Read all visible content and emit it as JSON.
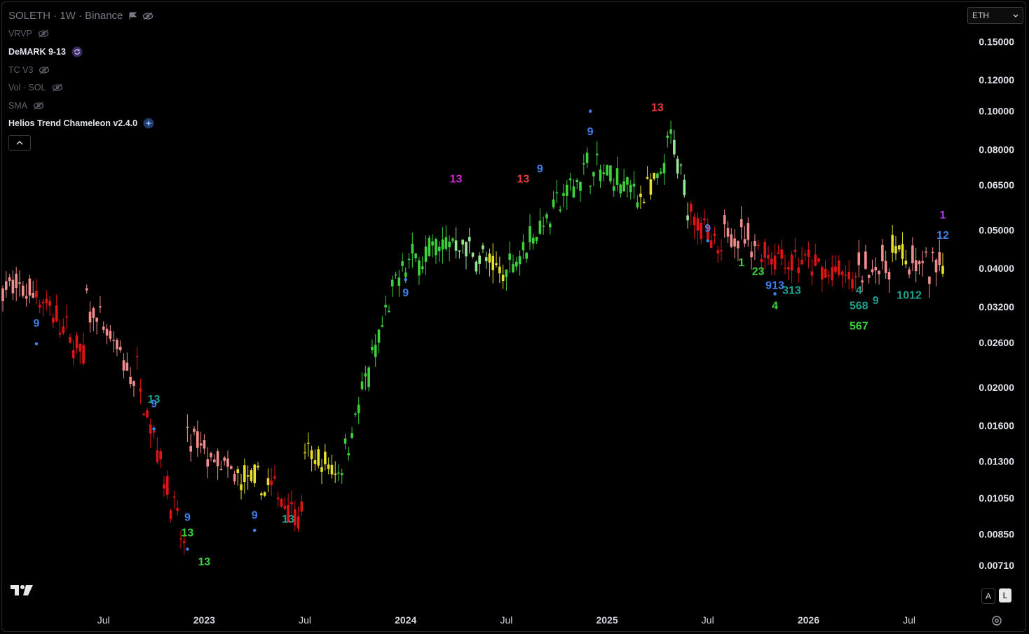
{
  "header": {
    "title": "SOLETH · 1W · Binance"
  },
  "indicators": [
    {
      "label": "VRVP",
      "visible": false
    },
    {
      "label": "DeMARK 9-13",
      "visible": true,
      "icon": "refresh-icon"
    },
    {
      "label": "TC V3",
      "visible": false
    },
    {
      "label": "Vol · SOL",
      "visible": false
    },
    {
      "label": "SMA",
      "visible": false
    },
    {
      "label": "Helios Trend Chameleon v2.4.0",
      "visible": true,
      "icon": "sparkle-icon"
    }
  ],
  "controls": {
    "symbol": "ETH",
    "scale_auto": "A",
    "scale_log": "L"
  },
  "colors": {
    "background": "#000000",
    "bull": "#3ed13e",
    "bull_light": "#98e698",
    "bear": "#e01414",
    "bear_light": "#f28d8d",
    "neutral": "#e6e12a",
    "td_blue": "#3f7fe8",
    "td_red": "#e83a3a",
    "td_magenta": "#d127d4",
    "td_green": "#3ed13e",
    "td_teal": "#1aa38f",
    "td_purple": "#a43fe0"
  },
  "chart_data": {
    "type": "candlestick",
    "scale": "log",
    "ylim": [
      0.0062,
      0.165
    ],
    "y_ticks": [
      "0.15000",
      "0.12000",
      "0.10000",
      "0.08000",
      "0.06500",
      "0.05000",
      "0.04000",
      "0.03200",
      "0.02600",
      "0.02000",
      "0.01600",
      "0.01300",
      "0.01050",
      "0.00850",
      "0.00710"
    ],
    "x_ticks": [
      "Jul",
      "2023",
      "Jul",
      "2024",
      "Jul",
      "2025",
      "Jul",
      "2026",
      "Jul"
    ],
    "x_tick_dates": [
      "2022-07",
      "2023-01",
      "2023-07",
      "2024-01",
      "2024-07",
      "2025-01",
      "2025-07",
      "2026-01",
      "2026-07"
    ],
    "date_range": [
      "2022-01",
      "2026-09"
    ],
    "series": [
      {
        "phase": "bear_light",
        "from": "2022-01",
        "to": "2022-03",
        "start": 0.036,
        "end": 0.035
      },
      {
        "phase": "bear",
        "from": "2022-03",
        "to": "2022-06",
        "start": 0.035,
        "end": 0.024
      },
      {
        "phase": "bear_light",
        "from": "2022-06",
        "to": "2022-09",
        "start": 0.033,
        "end": 0.021
      },
      {
        "phase": "bear",
        "from": "2022-09",
        "to": "2022-12",
        "start": 0.022,
        "end": 0.0078
      },
      {
        "phase": "bear_light",
        "from": "2022-12",
        "to": "2023-03",
        "start": 0.015,
        "end": 0.0118
      },
      {
        "phase": "neutral",
        "from": "2023-03",
        "to": "2023-05",
        "start": 0.0118,
        "end": 0.0112
      },
      {
        "phase": "bear",
        "from": "2023-05",
        "to": "2023-07",
        "start": 0.0112,
        "end": 0.0095
      },
      {
        "phase": "neutral",
        "from": "2023-07",
        "to": "2023-09",
        "start": 0.0135,
        "end": 0.0123
      },
      {
        "phase": "bull",
        "from": "2023-09",
        "to": "2024-01",
        "start": 0.0123,
        "end": 0.041
      },
      {
        "phase": "bull",
        "from": "2024-01",
        "to": "2024-04",
        "start": 0.041,
        "end": 0.047
      },
      {
        "phase": "bull_light",
        "from": "2024-04",
        "to": "2024-06",
        "start": 0.047,
        "end": 0.042
      },
      {
        "phase": "neutral",
        "from": "2024-06",
        "to": "2024-07",
        "start": 0.04,
        "end": 0.039
      },
      {
        "phase": "bull",
        "from": "2024-07",
        "to": "2024-12",
        "start": 0.04,
        "end": 0.072
      },
      {
        "phase": "bull",
        "from": "2024-12",
        "to": "2025-03",
        "start": 0.072,
        "end": 0.062
      },
      {
        "phase": "neutral",
        "from": "2025-03",
        "to": "2025-04",
        "start": 0.062,
        "end": 0.064
      },
      {
        "phase": "bull",
        "from": "2025-04",
        "to": "2025-05",
        "start": 0.064,
        "end": 0.085
      },
      {
        "phase": "bull_light",
        "from": "2025-05",
        "to": "2025-06",
        "start": 0.08,
        "end": 0.058
      },
      {
        "phase": "bear",
        "from": "2025-06",
        "to": "2025-08",
        "start": 0.058,
        "end": 0.041
      },
      {
        "phase": "bear_light",
        "from": "2025-08",
        "to": "2025-10",
        "start": 0.052,
        "end": 0.046
      },
      {
        "phase": "bear",
        "from": "2025-10",
        "to": "2026-04",
        "start": 0.045,
        "end": 0.037
      },
      {
        "phase": "bear_light",
        "from": "2026-04",
        "to": "2026-06",
        "start": 0.04,
        "end": 0.041
      },
      {
        "phase": "neutral",
        "from": "2026-06",
        "to": "2026-07",
        "start": 0.046,
        "end": 0.043
      },
      {
        "phase": "bear_light",
        "from": "2026-07",
        "to": "2026-09",
        "start": 0.041,
        "end": 0.04
      },
      {
        "phase": "neutral",
        "from": "2026-09",
        "to": "2026-09",
        "start": 0.04,
        "end": 0.042
      }
    ],
    "annotations": [
      {
        "text": "9",
        "date": "2022-03",
        "y": 0.0285,
        "color": "td_blue",
        "dot_y": 0.0258
      },
      {
        "text": "13",
        "date": "2022-10",
        "y": 0.0183,
        "color": "td_teal"
      },
      {
        "text": "9",
        "date": "2022-10",
        "y": 0.0178,
        "color": "td_blue",
        "dot_y": 0.0157
      },
      {
        "text": "9",
        "date": "2022-12",
        "y": 0.0092,
        "color": "td_blue"
      },
      {
        "text": "13",
        "date": "2022-12",
        "y": 0.0084,
        "color": "td_green",
        "dot_y": 0.0078
      },
      {
        "text": "13",
        "date": "2023-01",
        "y": 0.0071,
        "color": "td_green"
      },
      {
        "text": "9",
        "date": "2023-04",
        "y": 0.0093,
        "color": "td_blue",
        "dot_y": 0.0087
      },
      {
        "text": "13",
        "date": "2023-06",
        "y": 0.0091,
        "color": "td_teal"
      },
      {
        "text": "9",
        "date": "2024-01",
        "y": 0.034,
        "color": "td_blue",
        "dot_y": 0.0375
      },
      {
        "text": "13",
        "date": "2024-04",
        "y": 0.066,
        "color": "td_magenta"
      },
      {
        "text": "13",
        "date": "2024-08",
        "y": 0.066,
        "color": "td_red"
      },
      {
        "text": "9",
        "date": "2024-09",
        "y": 0.07,
        "color": "td_blue"
      },
      {
        "text": "9",
        "date": "2024-12",
        "y": 0.087,
        "color": "td_blue",
        "dot_y": 0.1
      },
      {
        "text": "13",
        "date": "2025-04",
        "y": 0.1,
        "color": "td_red"
      },
      {
        "text": "9",
        "date": "2025-07",
        "y": 0.0495,
        "color": "td_blue",
        "dot_y": 0.047
      },
      {
        "text": "1",
        "date": "2025-09",
        "y": 0.0405,
        "color": "td_green"
      },
      {
        "text": "23",
        "date": "2025-10",
        "y": 0.0385,
        "color": "td_green"
      },
      {
        "text": "913",
        "date": "2025-11",
        "y": 0.0355,
        "color": "td_blue"
      },
      {
        "text": "4",
        "date": "2025-11",
        "y": 0.0315,
        "color": "td_green",
        "dot_y": 0.0345
      },
      {
        "text": "313",
        "date": "2025-12",
        "y": 0.0345,
        "color": "td_teal"
      },
      {
        "text": "4",
        "date": "2026-04",
        "y": 0.0345,
        "color": "td_teal"
      },
      {
        "text": "568",
        "date": "2026-04",
        "y": 0.0315,
        "color": "td_teal"
      },
      {
        "text": "567",
        "date": "2026-04",
        "y": 0.028,
        "color": "td_green"
      },
      {
        "text": "9",
        "date": "2026-05",
        "y": 0.0325,
        "color": "td_teal"
      },
      {
        "text": "1012",
        "date": "2026-07",
        "y": 0.0335,
        "color": "td_teal"
      },
      {
        "text": "1",
        "date": "2026-09",
        "y": 0.0535,
        "color": "td_purple"
      },
      {
        "text": "12",
        "date": "2026-09",
        "y": 0.0475,
        "color": "td_blue"
      }
    ]
  }
}
